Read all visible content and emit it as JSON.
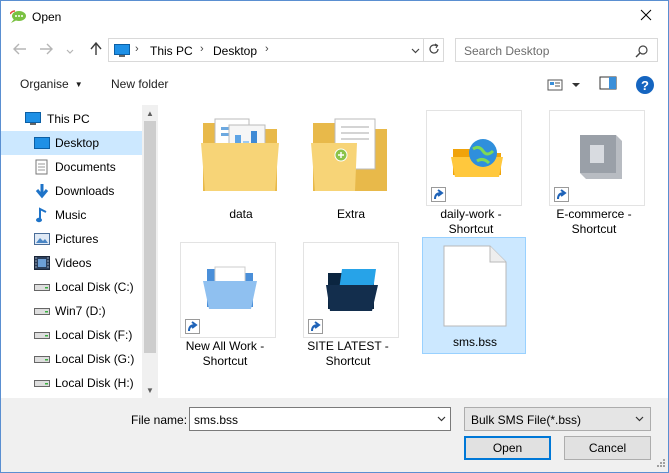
{
  "window": {
    "title": "Open",
    "app_icon": "chat-bubble-icon",
    "close_icon": "close-icon"
  },
  "nav": {
    "back_icon": "back-arrow-icon",
    "forward_icon": "forward-arrow-icon",
    "recent_icon": "chevron-down-icon",
    "up_icon": "up-arrow-icon"
  },
  "address": {
    "segments": [
      "This PC",
      "Desktop"
    ],
    "refresh_icon": "refresh-icon"
  },
  "search": {
    "placeholder": "Search Desktop"
  },
  "toolbar": {
    "organise_label": "Organise",
    "new_folder_label": "New folder",
    "help_label": "?"
  },
  "sidebar": {
    "items": [
      {
        "label": "This PC",
        "icon": "computer-icon"
      },
      {
        "label": "Desktop",
        "icon": "desktop-icon"
      },
      {
        "label": "Documents",
        "icon": "documents-icon"
      },
      {
        "label": "Downloads",
        "icon": "download-icon"
      },
      {
        "label": "Music",
        "icon": "music-icon"
      },
      {
        "label": "Pictures",
        "icon": "pictures-icon"
      },
      {
        "label": "Videos",
        "icon": "videos-icon"
      },
      {
        "label": "Local Disk (C:)",
        "icon": "disk-icon"
      },
      {
        "label": "Win7 (D:)",
        "icon": "disk-icon"
      },
      {
        "label": "Local Disk (F:)",
        "icon": "disk-icon"
      },
      {
        "label": "Local Disk (G:)",
        "icon": "disk-icon"
      },
      {
        "label": "Local Disk (H:)",
        "icon": "disk-icon"
      }
    ],
    "selected": "Desktop"
  },
  "files": [
    {
      "name": "data",
      "icon": "folder-icon"
    },
    {
      "name": "Extra",
      "icon": "folder-icon"
    },
    {
      "name": "daily-work - Shortcut",
      "icon": "globe-folder-icon"
    },
    {
      "name": "E-commerce - Shortcut",
      "icon": "book-icon"
    },
    {
      "name": "New All Work - Shortcut",
      "icon": "blue-folder-icon"
    },
    {
      "name": "SITE LATEST - Shortcut",
      "icon": "dark-folder-icon"
    },
    {
      "name": "sms.bss",
      "icon": "blank-file-icon"
    }
  ],
  "footer": {
    "file_name_label": "File name:",
    "file_name_value": "sms.bss",
    "filter_value": "Bulk SMS File(*.bss)",
    "open_label": "Open",
    "cancel_label": "Cancel"
  },
  "colors": {
    "selection": "#cce8ff",
    "accent": "#0078d7",
    "folder_yellow": "#f5d26e"
  }
}
